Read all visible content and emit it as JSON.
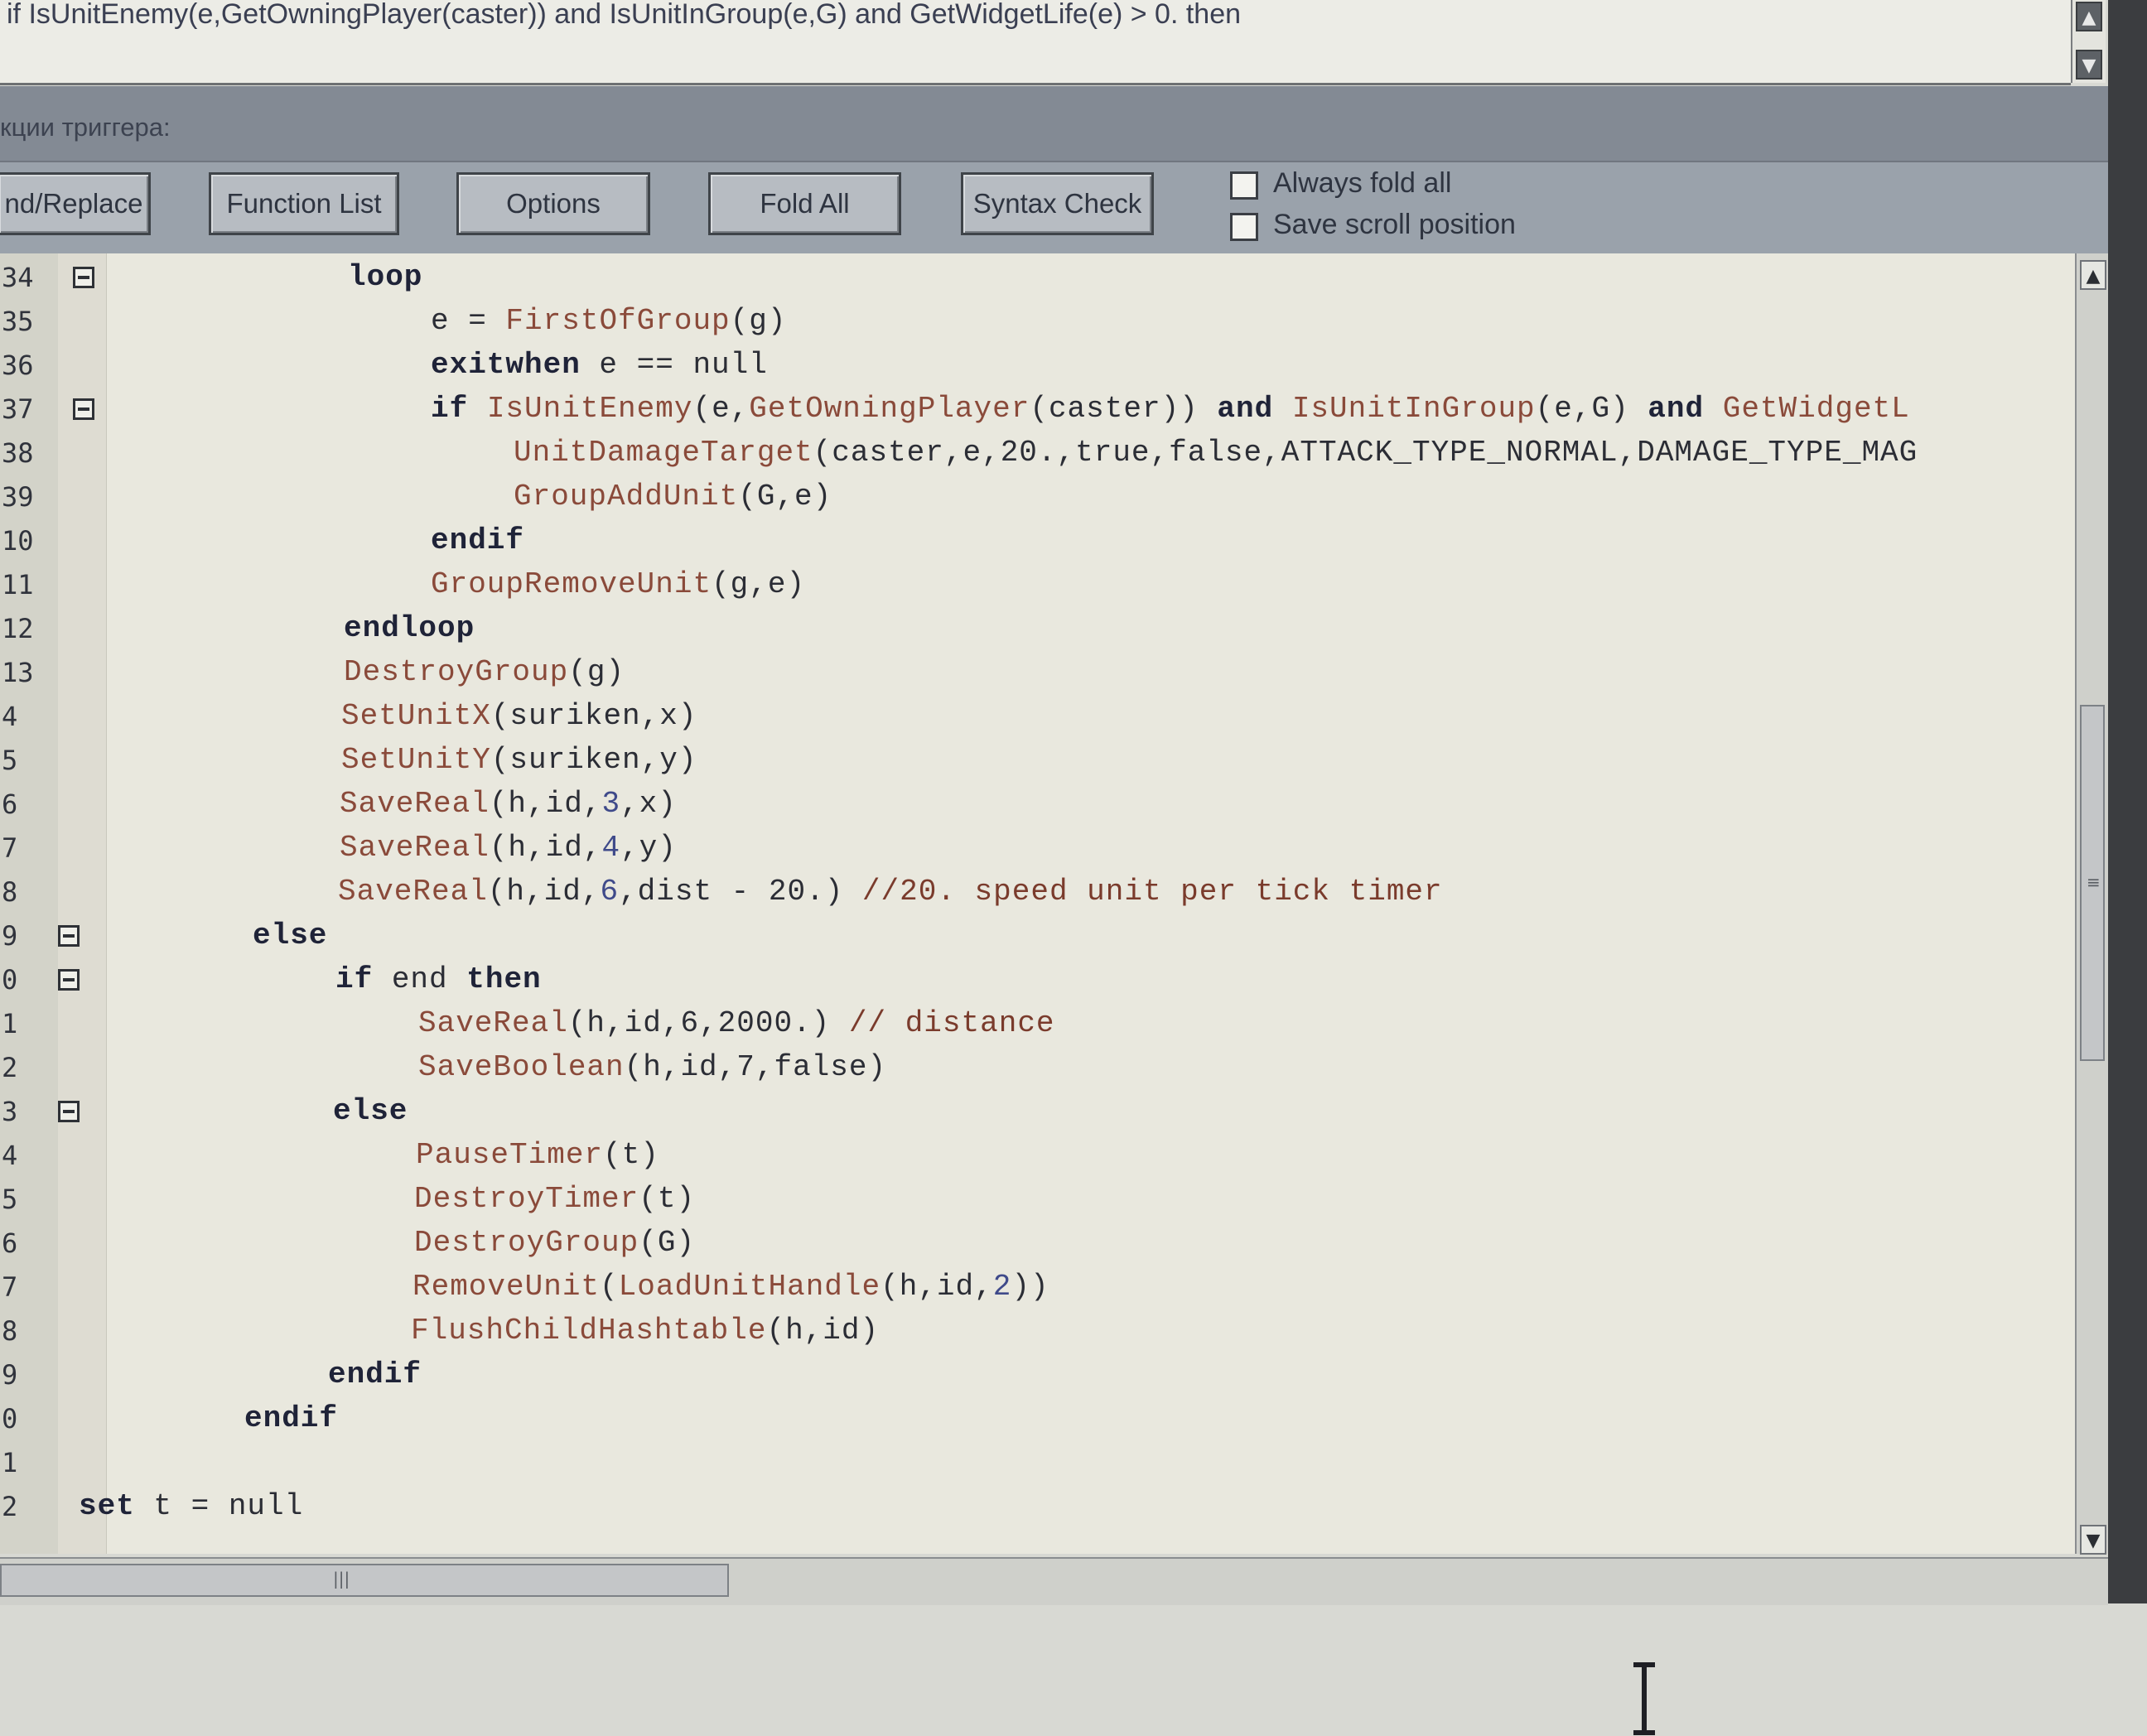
{
  "top_editor": {
    "text": "if IsUnitEnemy(e,GetOwningPlayer(caster)) and IsUnitInGroup(e,G) and GetWidgetLife(e) > 0. then"
  },
  "section_label": "кции триггера:",
  "toolbar": {
    "find_replace": "nd/Replace",
    "function_list": "Function List",
    "options": "Options",
    "fold_all": "Fold All",
    "syntax_check": "Syntax Check",
    "always_fold_all": "Always fold all",
    "save_scroll_position": "Save scroll position"
  },
  "gutter": {
    "line_numbers": [
      "34",
      "35",
      "36",
      "37",
      "38",
      "39",
      "10",
      "11",
      "12",
      "13",
      "4",
      "5",
      "6",
      "7",
      "8",
      "9",
      "0",
      "1",
      "2",
      "3",
      "4",
      "5",
      "6",
      "7",
      "8",
      "9",
      "0",
      "1",
      "2"
    ]
  },
  "code_lines": [
    [
      {
        "t": "loop",
        "c": "kw"
      }
    ],
    [
      {
        "t": "e = "
      },
      {
        "t": "FirstOfGroup",
        "c": "fn"
      },
      {
        "t": "(g)"
      }
    ],
    [
      {
        "t": "exitwhen",
        "c": "kw"
      },
      {
        "t": " e == null"
      }
    ],
    [
      {
        "t": "if",
        "c": "kw"
      },
      {
        "t": " "
      },
      {
        "t": "IsUnitEnemy",
        "c": "fn"
      },
      {
        "t": "(e,"
      },
      {
        "t": "GetOwningPlayer",
        "c": "fn"
      },
      {
        "t": "(caster)) "
      },
      {
        "t": "and",
        "c": "kw"
      },
      {
        "t": " "
      },
      {
        "t": "IsUnitInGroup",
        "c": "fn"
      },
      {
        "t": "(e,G) "
      },
      {
        "t": "and",
        "c": "kw"
      },
      {
        "t": " "
      },
      {
        "t": "GetWidgetL",
        "c": "fn"
      }
    ],
    [
      {
        "t": "UnitDamageTarget",
        "c": "fn"
      },
      {
        "t": "(caster,e,20.,true,false,ATTACK_TYPE_NORMAL,DAMAGE_TYPE_MAG"
      }
    ],
    [
      {
        "t": "GroupAddUnit",
        "c": "fn"
      },
      {
        "t": "(G,e)"
      }
    ],
    [
      {
        "t": "endif",
        "c": "kw"
      }
    ],
    [
      {
        "t": "GroupRemoveUnit",
        "c": "fn"
      },
      {
        "t": "(g,e)"
      }
    ],
    [
      {
        "t": "endloop",
        "c": "kw"
      }
    ],
    [
      {
        "t": "DestroyGroup",
        "c": "fn"
      },
      {
        "t": "(g)"
      }
    ],
    [
      {
        "t": "SetUnitX",
        "c": "fn"
      },
      {
        "t": "(suriken,x)"
      }
    ],
    [
      {
        "t": "SetUnitY",
        "c": "fn"
      },
      {
        "t": "(suriken,y)"
      }
    ],
    [
      {
        "t": "SaveReal",
        "c": "fn"
      },
      {
        "t": "(h,id,"
      },
      {
        "t": "3",
        "c": "nm"
      },
      {
        "t": ",x)"
      }
    ],
    [
      {
        "t": "SaveReal",
        "c": "fn"
      },
      {
        "t": "(h,id,"
      },
      {
        "t": "4",
        "c": "nm"
      },
      {
        "t": ",y)"
      }
    ],
    [
      {
        "t": "SaveReal",
        "c": "fn"
      },
      {
        "t": "(h,id,"
      },
      {
        "t": "6",
        "c": "nm"
      },
      {
        "t": ",dist - 20.) "
      },
      {
        "t": "//20. speed unit per tick timer",
        "c": "cm"
      }
    ],
    [
      {
        "t": "else",
        "c": "kw"
      }
    ],
    [
      {
        "t": "if",
        "c": "kw"
      },
      {
        "t": " end "
      },
      {
        "t": "then",
        "c": "kw"
      }
    ],
    [
      {
        "t": "SaveReal",
        "c": "fn"
      },
      {
        "t": "(h,id,6,2000.) "
      },
      {
        "t": "// distance",
        "c": "cm"
      }
    ],
    [
      {
        "t": "SaveBoolean",
        "c": "fn"
      },
      {
        "t": "(h,id,7,false)"
      }
    ],
    [
      {
        "t": "else",
        "c": "kw"
      }
    ],
    [
      {
        "t": "PauseTimer",
        "c": "fn"
      },
      {
        "t": "(t)"
      }
    ],
    [
      {
        "t": "DestroyTimer",
        "c": "fn"
      },
      {
        "t": "(t)"
      }
    ],
    [
      {
        "t": "DestroyGroup",
        "c": "fn"
      },
      {
        "t": "(G)"
      }
    ],
    [
      {
        "t": "RemoveUnit",
        "c": "fn"
      },
      {
        "t": "("
      },
      {
        "t": "LoadUnitHandle",
        "c": "fn"
      },
      {
        "t": "(h,id,"
      },
      {
        "t": "2",
        "c": "nm"
      },
      {
        "t": "))"
      }
    ],
    [
      {
        "t": "FlushChildHashtable",
        "c": "fn"
      },
      {
        "t": "(h,id)"
      }
    ],
    [
      {
        "t": "endif",
        "c": "kw"
      }
    ],
    [
      {
        "t": "endif",
        "c": "kw"
      }
    ],
    [],
    [
      {
        "t": "set",
        "c": "kw"
      },
      {
        "t": " t = null"
      }
    ]
  ],
  "icons": {
    "scroll_up": "chevron-up-icon",
    "scroll_down": "chevron-down-icon",
    "fold": "minus-box-icon",
    "cursor": "text-cursor-icon"
  }
}
